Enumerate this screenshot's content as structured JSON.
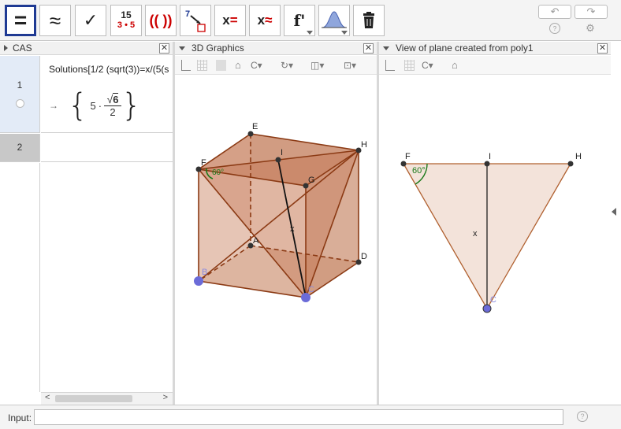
{
  "toolbar": {
    "tools": [
      {
        "name": "evaluate",
        "label": "="
      },
      {
        "name": "numeric",
        "label": "≈"
      },
      {
        "name": "keep-input",
        "label": "✓"
      },
      {
        "name": "factor",
        "label_top": "15",
        "label_bottom": "3 • 5"
      },
      {
        "name": "expand",
        "label": "(( ))"
      },
      {
        "name": "substitute",
        "label": "7"
      },
      {
        "name": "solve",
        "label": "x="
      },
      {
        "name": "solve-numerically",
        "label": "x≈"
      },
      {
        "name": "derivative",
        "label": "f'"
      },
      {
        "name": "probability",
        "label": ""
      },
      {
        "name": "delete",
        "label": ""
      }
    ]
  },
  "cas": {
    "title": "CAS",
    "rows": [
      {
        "num": "1",
        "input": "Solutions[1/2 (sqrt(3))=x/(5(s",
        "output_arrow": "→",
        "output_coef": "5",
        "output_dot": "·",
        "output_sqrt": "6",
        "output_den": "2"
      },
      {
        "num": "2",
        "input": ""
      }
    ]
  },
  "graphics3d": {
    "title": "3D Graphics",
    "labels": {
      "E": "E",
      "F": "F",
      "I": "I",
      "H": "H",
      "G": "G",
      "A": "A",
      "D": "D",
      "B": "B",
      "C": "C",
      "x": "x",
      "angle": "60°"
    }
  },
  "plane": {
    "title": "View of plane created from poly1",
    "labels": {
      "F": "F",
      "I": "I",
      "H": "H",
      "C": "C",
      "x": "x",
      "angle": "60°"
    }
  },
  "inputbar": {
    "label": "Input:",
    "value": "",
    "placeholder": ""
  },
  "colors": {
    "accent": "#1f3a93",
    "face": "#c98b6c",
    "edge": "#8b3a14",
    "point": "#6b6bd8",
    "angle": "#1a7a1a"
  }
}
